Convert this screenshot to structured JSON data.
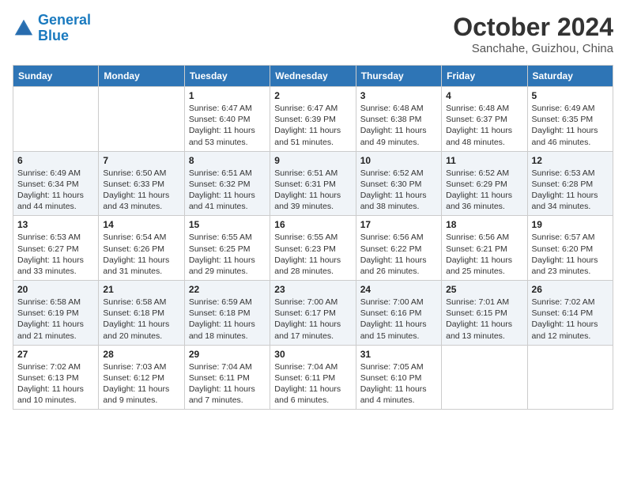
{
  "header": {
    "logo_line1": "General",
    "logo_line2": "Blue",
    "month": "October 2024",
    "location": "Sanchahe, Guizhou, China"
  },
  "days_of_week": [
    "Sunday",
    "Monday",
    "Tuesday",
    "Wednesday",
    "Thursday",
    "Friday",
    "Saturday"
  ],
  "weeks": [
    [
      {
        "day": "",
        "info": ""
      },
      {
        "day": "",
        "info": ""
      },
      {
        "day": "1",
        "info": "Sunrise: 6:47 AM\nSunset: 6:40 PM\nDaylight: 11 hours and 53 minutes."
      },
      {
        "day": "2",
        "info": "Sunrise: 6:47 AM\nSunset: 6:39 PM\nDaylight: 11 hours and 51 minutes."
      },
      {
        "day": "3",
        "info": "Sunrise: 6:48 AM\nSunset: 6:38 PM\nDaylight: 11 hours and 49 minutes."
      },
      {
        "day": "4",
        "info": "Sunrise: 6:48 AM\nSunset: 6:37 PM\nDaylight: 11 hours and 48 minutes."
      },
      {
        "day": "5",
        "info": "Sunrise: 6:49 AM\nSunset: 6:35 PM\nDaylight: 11 hours and 46 minutes."
      }
    ],
    [
      {
        "day": "6",
        "info": "Sunrise: 6:49 AM\nSunset: 6:34 PM\nDaylight: 11 hours and 44 minutes."
      },
      {
        "day": "7",
        "info": "Sunrise: 6:50 AM\nSunset: 6:33 PM\nDaylight: 11 hours and 43 minutes."
      },
      {
        "day": "8",
        "info": "Sunrise: 6:51 AM\nSunset: 6:32 PM\nDaylight: 11 hours and 41 minutes."
      },
      {
        "day": "9",
        "info": "Sunrise: 6:51 AM\nSunset: 6:31 PM\nDaylight: 11 hours and 39 minutes."
      },
      {
        "day": "10",
        "info": "Sunrise: 6:52 AM\nSunset: 6:30 PM\nDaylight: 11 hours and 38 minutes."
      },
      {
        "day": "11",
        "info": "Sunrise: 6:52 AM\nSunset: 6:29 PM\nDaylight: 11 hours and 36 minutes."
      },
      {
        "day": "12",
        "info": "Sunrise: 6:53 AM\nSunset: 6:28 PM\nDaylight: 11 hours and 34 minutes."
      }
    ],
    [
      {
        "day": "13",
        "info": "Sunrise: 6:53 AM\nSunset: 6:27 PM\nDaylight: 11 hours and 33 minutes."
      },
      {
        "day": "14",
        "info": "Sunrise: 6:54 AM\nSunset: 6:26 PM\nDaylight: 11 hours and 31 minutes."
      },
      {
        "day": "15",
        "info": "Sunrise: 6:55 AM\nSunset: 6:25 PM\nDaylight: 11 hours and 29 minutes."
      },
      {
        "day": "16",
        "info": "Sunrise: 6:55 AM\nSunset: 6:23 PM\nDaylight: 11 hours and 28 minutes."
      },
      {
        "day": "17",
        "info": "Sunrise: 6:56 AM\nSunset: 6:22 PM\nDaylight: 11 hours and 26 minutes."
      },
      {
        "day": "18",
        "info": "Sunrise: 6:56 AM\nSunset: 6:21 PM\nDaylight: 11 hours and 25 minutes."
      },
      {
        "day": "19",
        "info": "Sunrise: 6:57 AM\nSunset: 6:20 PM\nDaylight: 11 hours and 23 minutes."
      }
    ],
    [
      {
        "day": "20",
        "info": "Sunrise: 6:58 AM\nSunset: 6:19 PM\nDaylight: 11 hours and 21 minutes."
      },
      {
        "day": "21",
        "info": "Sunrise: 6:58 AM\nSunset: 6:18 PM\nDaylight: 11 hours and 20 minutes."
      },
      {
        "day": "22",
        "info": "Sunrise: 6:59 AM\nSunset: 6:18 PM\nDaylight: 11 hours and 18 minutes."
      },
      {
        "day": "23",
        "info": "Sunrise: 7:00 AM\nSunset: 6:17 PM\nDaylight: 11 hours and 17 minutes."
      },
      {
        "day": "24",
        "info": "Sunrise: 7:00 AM\nSunset: 6:16 PM\nDaylight: 11 hours and 15 minutes."
      },
      {
        "day": "25",
        "info": "Sunrise: 7:01 AM\nSunset: 6:15 PM\nDaylight: 11 hours and 13 minutes."
      },
      {
        "day": "26",
        "info": "Sunrise: 7:02 AM\nSunset: 6:14 PM\nDaylight: 11 hours and 12 minutes."
      }
    ],
    [
      {
        "day": "27",
        "info": "Sunrise: 7:02 AM\nSunset: 6:13 PM\nDaylight: 11 hours and 10 minutes."
      },
      {
        "day": "28",
        "info": "Sunrise: 7:03 AM\nSunset: 6:12 PM\nDaylight: 11 hours and 9 minutes."
      },
      {
        "day": "29",
        "info": "Sunrise: 7:04 AM\nSunset: 6:11 PM\nDaylight: 11 hours and 7 minutes."
      },
      {
        "day": "30",
        "info": "Sunrise: 7:04 AM\nSunset: 6:11 PM\nDaylight: 11 hours and 6 minutes."
      },
      {
        "day": "31",
        "info": "Sunrise: 7:05 AM\nSunset: 6:10 PM\nDaylight: 11 hours and 4 minutes."
      },
      {
        "day": "",
        "info": ""
      },
      {
        "day": "",
        "info": ""
      }
    ]
  ]
}
